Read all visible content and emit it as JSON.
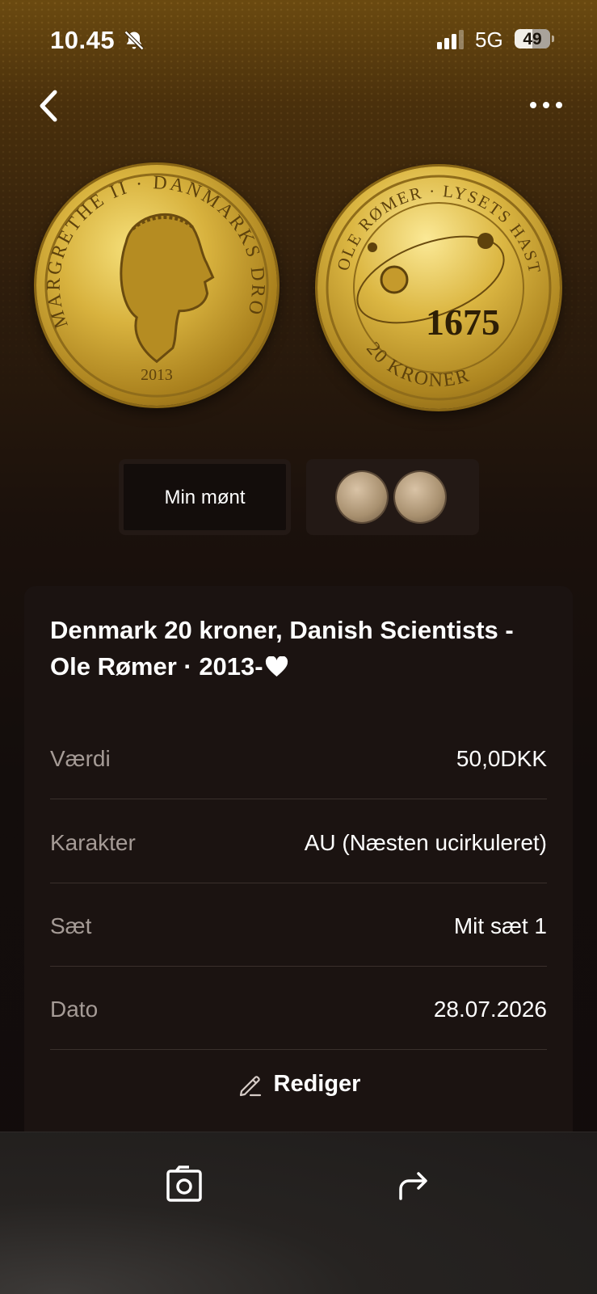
{
  "status_bar": {
    "time": "10.45",
    "network": "5G",
    "battery": "49"
  },
  "coin_thumbnails": {
    "mine_label": "Min mønt"
  },
  "coin": {
    "title": "Denmark 20 kroner, Danish Scientists - Ole Rømer · 2013-",
    "obverse_inscription": "MARGRETHE II · DANMARKS DRONNING",
    "obverse_year": "2013",
    "reverse_inscription": "OLE RØMER · LYSETS HASTIGHED",
    "reverse_year": "1675",
    "reverse_value": "20 KRONER"
  },
  "details": [
    {
      "label": "Værdi",
      "value": "50,0DKK"
    },
    {
      "label": "Karakter",
      "value": "AU (Næsten ucirkuleret)"
    },
    {
      "label": "Sæt",
      "value": "Mit sæt 1"
    },
    {
      "label": "Dato",
      "value": "28.07.2026"
    }
  ],
  "actions": {
    "edit_label": "Rediger"
  },
  "icons": {
    "status": [
      "bell-muted-icon",
      "signal-icon",
      "battery-icon"
    ],
    "nav": [
      "back-chevron-icon",
      "more-dots-icon"
    ],
    "card": [
      "heart-icon",
      "pencil-icon"
    ],
    "toolbar": [
      "camera-icon",
      "share-icon"
    ]
  },
  "colors": {
    "background": "#130d0c",
    "card": "#1b1311",
    "label": "#a59b96",
    "gold": "#d8b23e"
  }
}
